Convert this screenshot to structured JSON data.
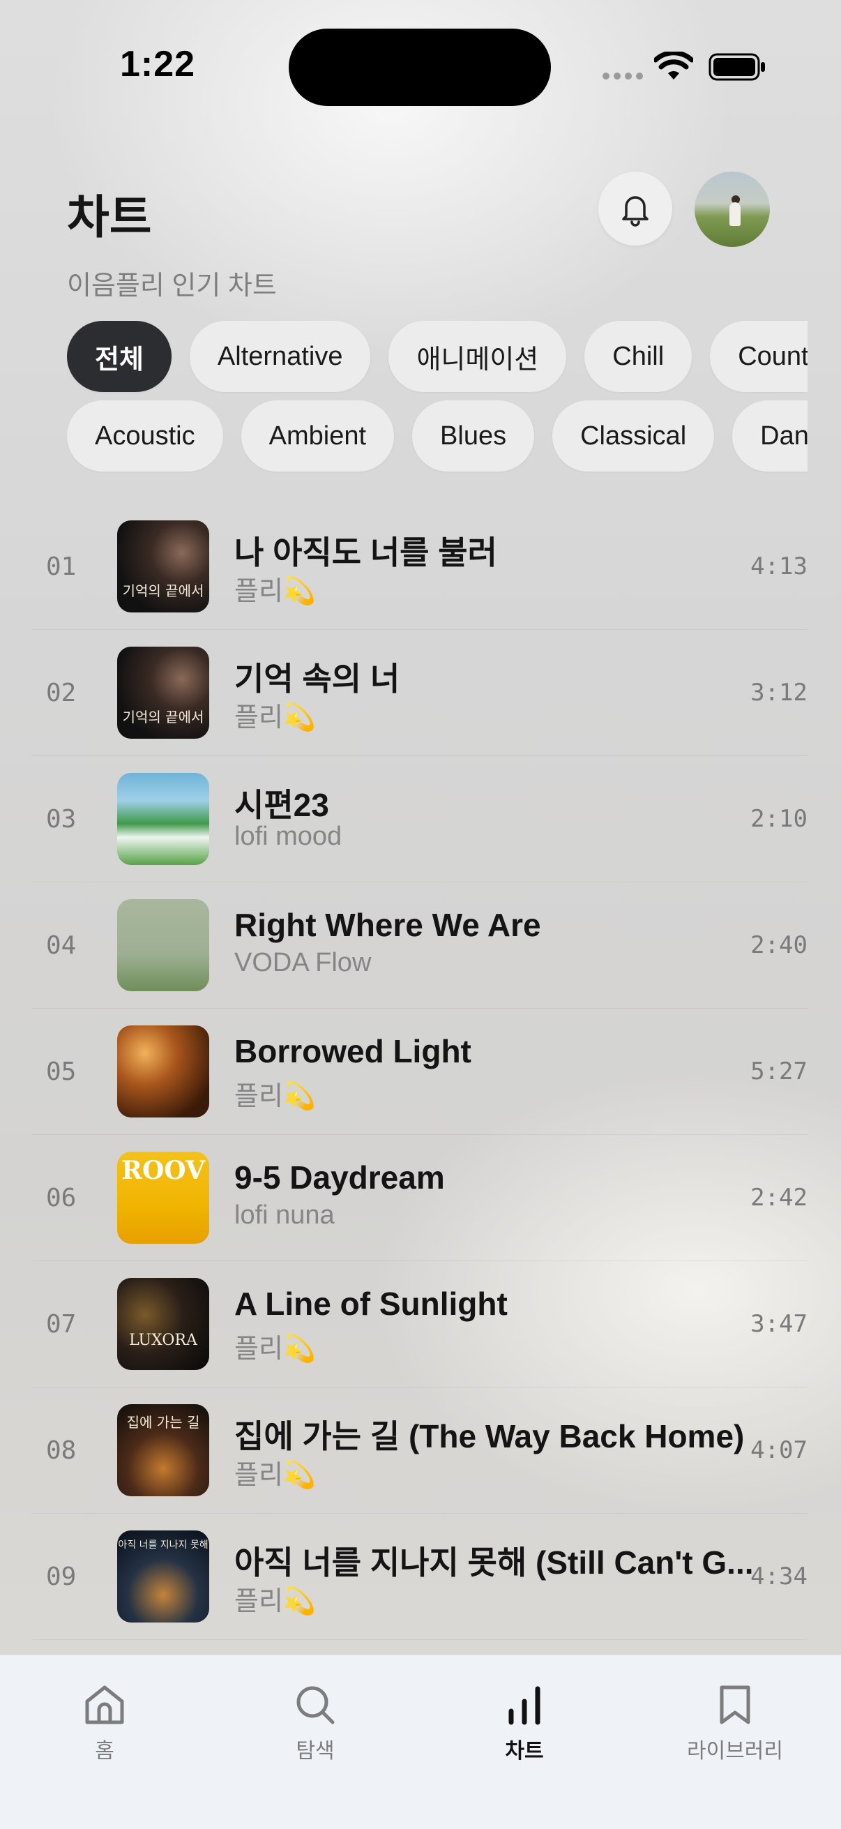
{
  "status_bar": {
    "time": "1:22"
  },
  "header": {
    "title": "차트",
    "subtitle": "이음플리 인기 차트"
  },
  "genres_row1": [
    "전체",
    "Alternative",
    "애니메이션",
    "Chill",
    "Country"
  ],
  "genres_row2": [
    "Acoustic",
    "Ambient",
    "Blues",
    "Classical",
    "Dance"
  ],
  "active_genre": "전체",
  "tracks": [
    {
      "rank": "01",
      "title": "나 아직도 너를 불러",
      "artist": "플리💫",
      "duration": "4:13",
      "cover": "c-dark",
      "cover_text": "기억의 끝에서"
    },
    {
      "rank": "02",
      "title": "기억 속의 너",
      "artist": "플리💫",
      "duration": "3:12",
      "cover": "c-dark",
      "cover_text": "기억의 끝에서"
    },
    {
      "rank": "03",
      "title": "시편23",
      "artist": "lofi mood",
      "duration": "2:10",
      "cover": "c-sheep",
      "cover_text": ""
    },
    {
      "rank": "04",
      "title": "Right Where We Are",
      "artist": "VODA Flow",
      "duration": "2:40",
      "cover": "c-tulip",
      "cover_text": ""
    },
    {
      "rank": "05",
      "title": "Borrowed Light",
      "artist": "플리💫",
      "duration": "5:27",
      "cover": "c-light",
      "cover_text": ""
    },
    {
      "rank": "06",
      "title": "9-5 Daydream",
      "artist": "lofi nuna",
      "duration": "2:42",
      "cover": "c-dog",
      "cover_text": "ROOV"
    },
    {
      "rank": "07",
      "title": "A Line of Sunlight",
      "artist": "플리💫",
      "duration": "3:47",
      "cover": "c-luxora",
      "cover_text": "LUXORA"
    },
    {
      "rank": "08",
      "title": "집에 가는 길 (The Way Back Home)",
      "artist": "플리💫",
      "duration": "4:07",
      "cover": "c-home",
      "cover_text": "집에 가는 길"
    },
    {
      "rank": "09",
      "title": "아직 너를 지나지 못해 (Still Can't G...",
      "artist": "플리💫",
      "duration": "4:34",
      "cover": "c-night",
      "cover_text": "아직 너를 지나지 못해"
    }
  ],
  "tab_bar": {
    "home": "홈",
    "search": "탐색",
    "chart": "차트",
    "library": "라이브러리"
  },
  "colors": {
    "accent_dark": "#2b2d30",
    "chip_bg": "#ececec",
    "tab_bar_bg": "#eff2f6"
  }
}
